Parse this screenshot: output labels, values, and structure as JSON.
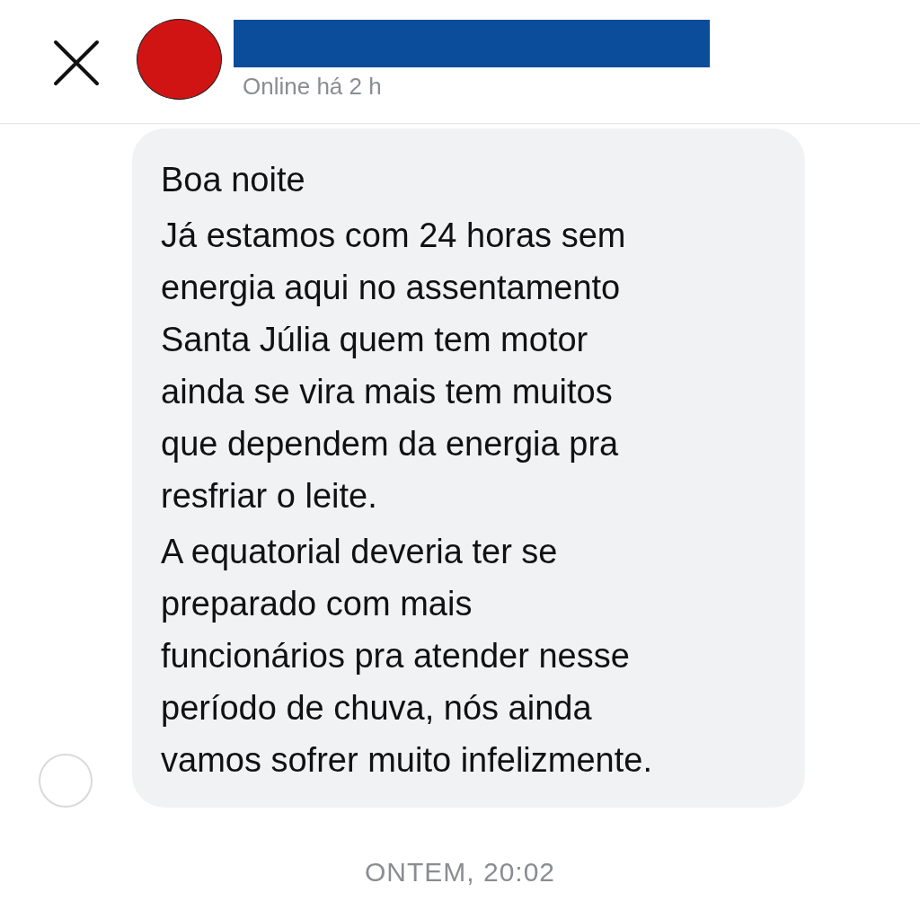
{
  "header": {
    "contact": {
      "status": "Online há 2 h"
    }
  },
  "message": {
    "paragraphs": [
      {
        "lines": [
          "Boa noite"
        ]
      },
      {
        "lines": [
          "Já estamos com 24 horas sem",
          "energia aqui no assentamento",
          "Santa Júlia quem tem motor",
          "ainda se vira mais tem muitos",
          "que dependem da energia pra",
          "resfriar o leite."
        ]
      },
      {
        "lines": [
          "A equatorial deveria ter se",
          "preparado com mais",
          "funcionários pra atender nesse",
          "período de chuva, nós ainda",
          "vamos sofrer muito infelizmente."
        ]
      }
    ]
  },
  "timestamp": "ONTEM, 20:02"
}
